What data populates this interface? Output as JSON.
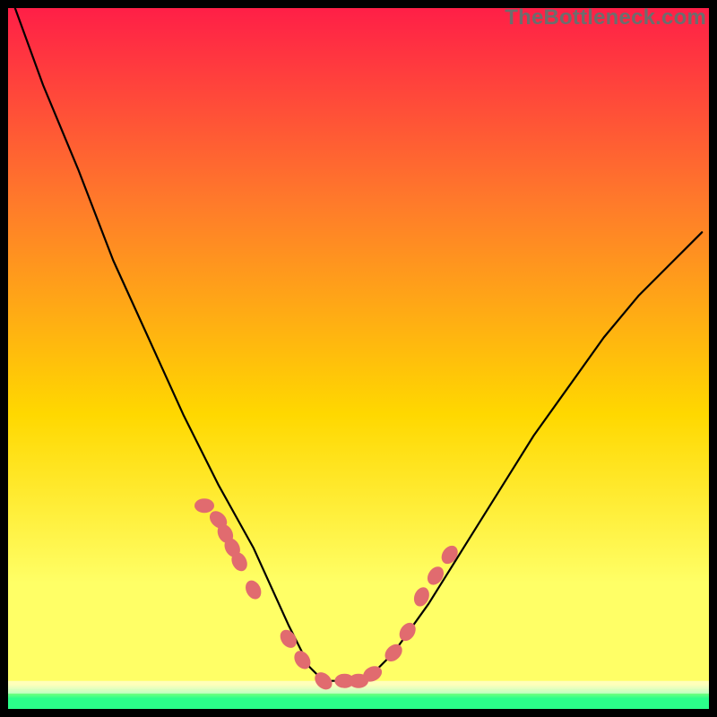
{
  "watermark": "TheBottleneck.com",
  "chart_data": {
    "type": "line",
    "title": "",
    "xlabel": "",
    "ylabel": "",
    "xlim": [
      0,
      100
    ],
    "ylim": [
      0,
      100
    ],
    "grid": false,
    "legend": false,
    "background_gradient": {
      "top": "#ff1f47",
      "mid_upper": "#ff7b2a",
      "mid": "#ffd800",
      "mid_lower": "#ffff66",
      "bottom": "#2bff8a"
    },
    "series": [
      {
        "name": "curve",
        "color": "#000000",
        "x": [
          1,
          5,
          10,
          15,
          20,
          25,
          30,
          35,
          40,
          43,
          45,
          48,
          50,
          52,
          55,
          60,
          65,
          70,
          75,
          80,
          85,
          90,
          95,
          99
        ],
        "y": [
          100,
          89,
          77,
          64,
          53,
          42,
          32,
          23,
          12,
          6,
          4,
          4,
          4,
          5,
          8,
          15,
          23,
          31,
          39,
          46,
          53,
          59,
          64,
          68
        ]
      },
      {
        "name": "curve-markers",
        "color": "#e16b6f",
        "marker": "ellipse",
        "x": [
          28,
          30,
          31,
          32,
          33,
          35,
          40,
          42,
          45,
          48,
          50,
          52,
          55,
          57,
          59,
          61,
          63
        ],
        "y": [
          29,
          27,
          25,
          23,
          21,
          17,
          10,
          7,
          4,
          4,
          4,
          5,
          8,
          11,
          16,
          19,
          22
        ]
      }
    ],
    "frame": {
      "stroke": "#000000",
      "stroke_width": 9
    },
    "bottom_stripes": [
      {
        "color": "#ffffff",
        "y_frac_from_bottom": 0.04,
        "height_frac": 0.012
      },
      {
        "color": "#ffffff",
        "y_frac_from_bottom": 0.028,
        "height_frac": 0.006
      }
    ]
  }
}
